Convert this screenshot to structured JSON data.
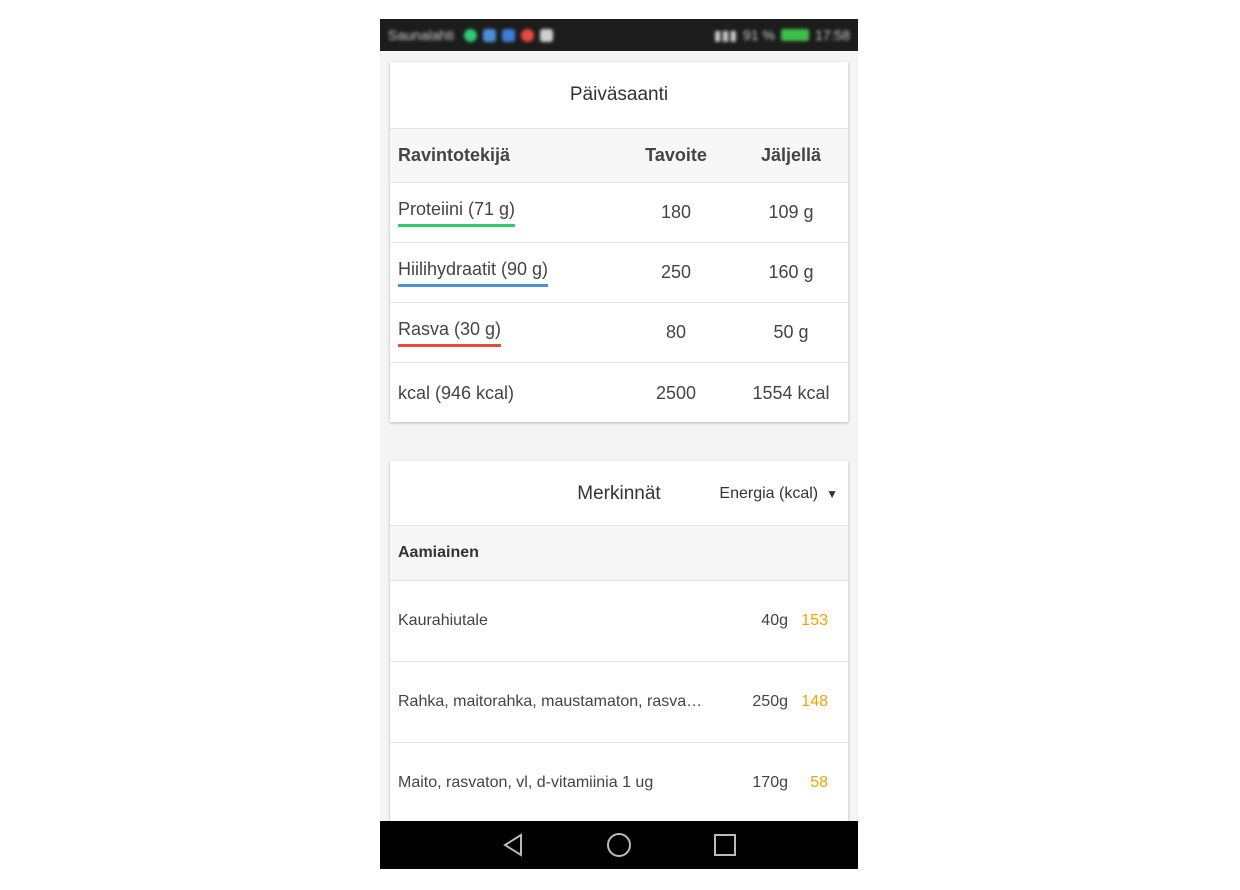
{
  "status_bar": {
    "carrier": "Saunalahti",
    "right_text": "91 %",
    "time": "17:58"
  },
  "intake": {
    "title": "Päiväsaanti",
    "headers": {
      "nutrient": "Ravintotekijä",
      "goal": "Tavoite",
      "remaining": "Jäljellä"
    },
    "rows": [
      {
        "name": "Proteiini (71 g)",
        "goal": "180",
        "remaining": "109 g",
        "underline_color": "#2ecc71"
      },
      {
        "name": "Hiilihydraatit (90 g)",
        "goal": "250",
        "remaining": "160 g",
        "underline_color": "#4a90d9"
      },
      {
        "name": "Rasva (30 g)",
        "goal": "80",
        "remaining": "50 g",
        "underline_color": "#e74c3c"
      },
      {
        "name": "kcal (946 kcal)",
        "goal": "2500",
        "remaining": "1554 kcal",
        "underline_color": ""
      }
    ]
  },
  "entries": {
    "title": "Merkinnät",
    "selected_metric": "Energia (kcal)",
    "meal": "Aamiainen",
    "value_color": "#f0a500",
    "items": [
      {
        "name": "Kaurahiutale",
        "amount": "40g",
        "value": "153"
      },
      {
        "name": "Rahka, maitorahka, maustamaton, rasva…",
        "amount": "250g",
        "value": "148"
      },
      {
        "name": "Maito, rasvaton, vl, d-vitamiinia 1 ug",
        "amount": "170g",
        "value": "58"
      }
    ]
  }
}
